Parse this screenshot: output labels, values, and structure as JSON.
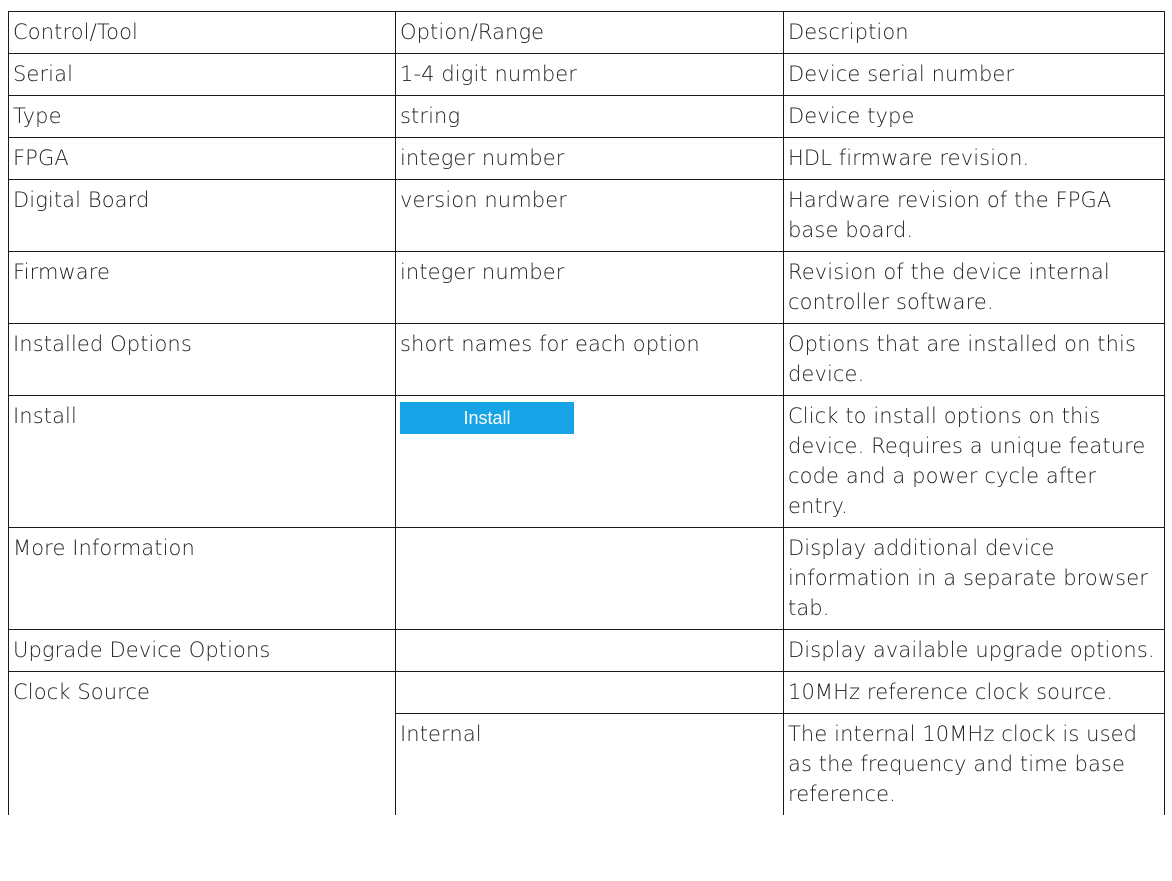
{
  "table": {
    "headers": [
      "Control/Tool",
      "Option/Range",
      "Description"
    ],
    "rows": [
      {
        "control": "Serial",
        "option": "1-4 digit number",
        "description": "Device serial number"
      },
      {
        "control": "Type",
        "option": "string",
        "description": "Device type"
      },
      {
        "control": "FPGA",
        "option": "integer number",
        "description": "HDL firmware revision."
      },
      {
        "control": "Digital Board",
        "option": "version number",
        "description": "Hardware revision of the FPGA base board."
      },
      {
        "control": "Firmware",
        "option": "integer number",
        "description": "Revision of the device internal controller software."
      },
      {
        "control": "Installed Options",
        "option": "short names for each option",
        "description": "Options that are installed on this device."
      },
      {
        "control": "Install",
        "button_label": "Install",
        "description": "Click to install options on this device. Requires a unique feature code and a power cycle after entry."
      },
      {
        "control": "More Information",
        "option": "",
        "description": "Display additional device information in a separate browser tab."
      },
      {
        "control": "Upgrade Device Options",
        "option": "",
        "description": "Display available upgrade options."
      },
      {
        "control": "Clock Source",
        "option": "",
        "description": "10MHz reference clock source."
      }
    ],
    "clock_source_options": [
      {
        "option": "Internal",
        "description": "The internal 10MHz clock is used as the frequency and time base reference."
      }
    ]
  },
  "colors": {
    "button_bg": "#16a4e6",
    "border": "#1a1a1a"
  }
}
